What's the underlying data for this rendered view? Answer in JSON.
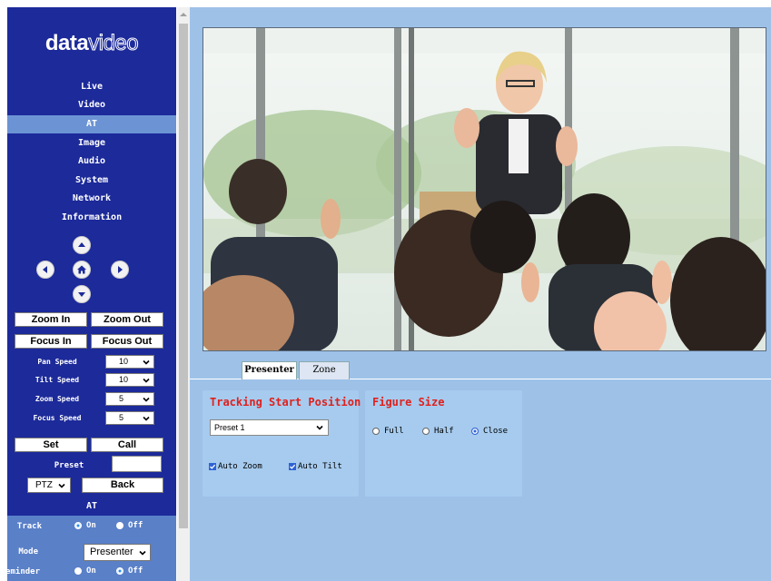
{
  "brand": {
    "logo_bold": "data",
    "logo_thin": "video"
  },
  "nav": {
    "items": [
      {
        "label": "Live",
        "active": false
      },
      {
        "label": "Video",
        "active": false
      },
      {
        "label": "AT",
        "active": true
      },
      {
        "label": "Image",
        "active": false
      },
      {
        "label": "Audio",
        "active": false
      },
      {
        "label": "System",
        "active": false
      },
      {
        "label": "Network",
        "active": false
      },
      {
        "label": "Information",
        "active": false
      }
    ]
  },
  "ptz": {
    "direction_icons": [
      "up-arrow-icon",
      "left-arrow-icon",
      "home-icon",
      "right-arrow-icon",
      "down-arrow-icon"
    ],
    "zoom_in": "Zoom In",
    "zoom_out": "Zoom Out",
    "focus_in": "Focus In",
    "focus_out": "Focus Out",
    "speeds": [
      {
        "label": "Pan Speed",
        "value": "10"
      },
      {
        "label": "Tilt Speed",
        "value": "10"
      },
      {
        "label": "Zoom Speed",
        "value": "5"
      },
      {
        "label": "Focus Speed",
        "value": "5"
      }
    ],
    "set": "Set",
    "call": "Call",
    "preset_label": "Preset",
    "preset_value": "",
    "mode_select": "PTZ",
    "back": "Back"
  },
  "at_panel": {
    "title": "AT",
    "track_label": "Track",
    "track_on": "On",
    "track_off": "Off",
    "track_selected": "On",
    "mode_label": "Mode",
    "mode_value": "Presenter",
    "reminder_label": "reminder",
    "reminder_on": "On",
    "reminder_off": "Off",
    "reminder_selected": "Off"
  },
  "tabs": {
    "presenter": "Presenter",
    "zone": "Zone",
    "active": "Presenter"
  },
  "tracking": {
    "title": "Tracking Start Position",
    "preset_value": "Preset 1",
    "auto_zoom": "Auto Zoom",
    "auto_zoom_checked": true,
    "auto_tilt": "Auto Tilt",
    "auto_tilt_checked": true
  },
  "figure": {
    "title": "Figure Size",
    "options": [
      "Full",
      "Half",
      "Close"
    ],
    "selected": "Close"
  },
  "colors": {
    "sidebar": "#1c2a9a",
    "nav_active": "#6c94d4",
    "main_bg": "#9ec1e8",
    "panel_bg": "#a6cbee",
    "title_red": "#e0201c",
    "check_blue": "#2f62d6"
  }
}
